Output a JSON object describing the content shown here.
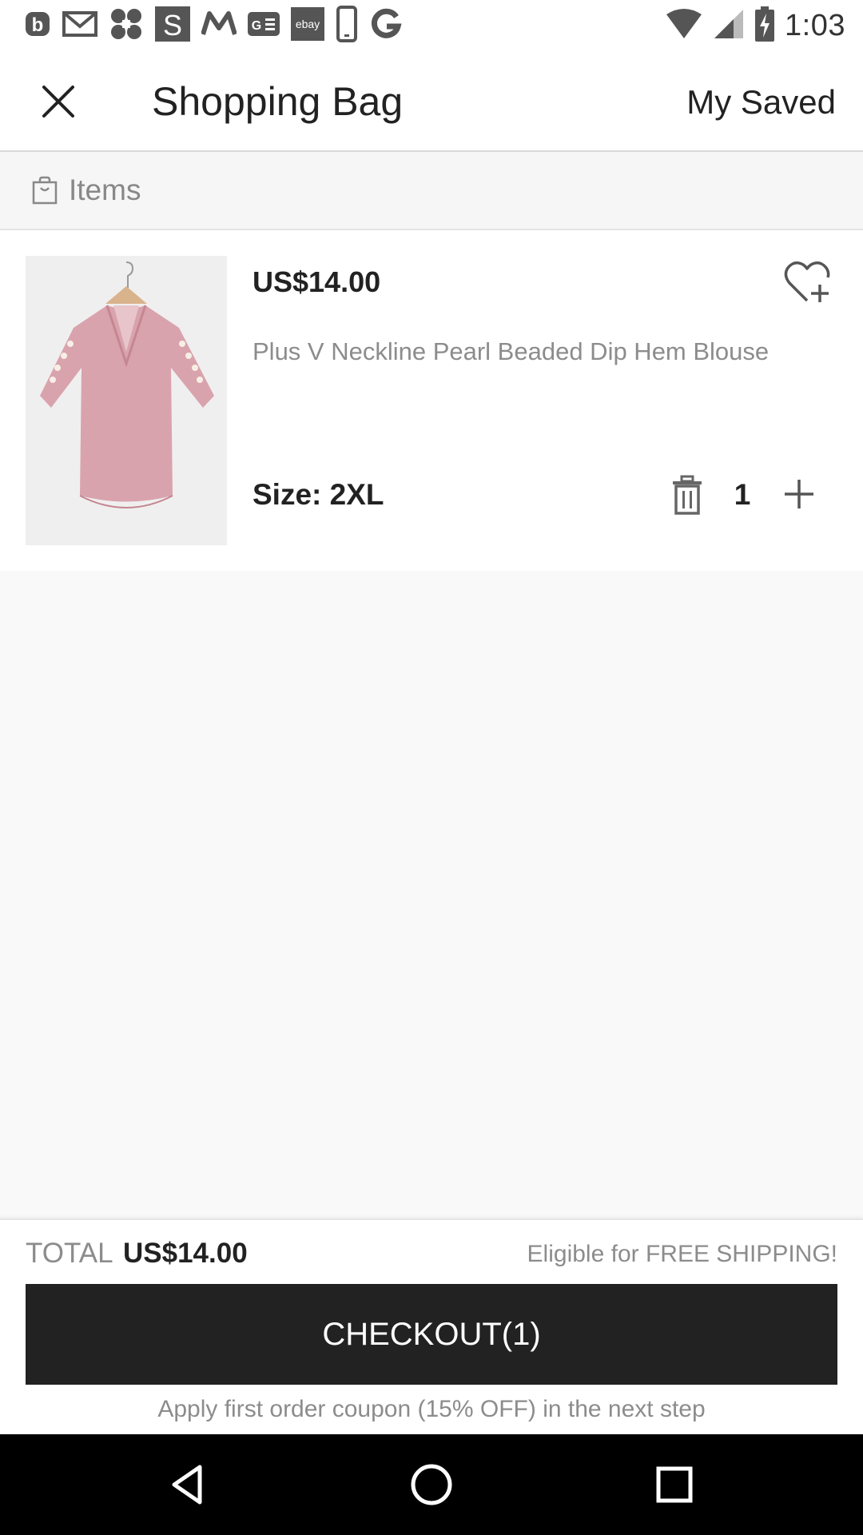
{
  "status_bar": {
    "time": "1:03",
    "notification_icons": [
      "b-app-icon",
      "gmail-icon",
      "pinwheel-app-icon",
      "s-app-icon",
      "myntra-icon",
      "news-icon",
      "ebay-icon",
      "phone-device-icon",
      "g-app-icon"
    ],
    "ebay_label": "ebay",
    "system_icons": [
      "wifi-icon",
      "signal-icon",
      "battery-charging-icon"
    ]
  },
  "header": {
    "title": "Shopping Bag",
    "my_saved_label": "My Saved"
  },
  "items_section": {
    "label": "Items"
  },
  "cart_item": {
    "price": "US$14.00",
    "name": "Plus V Neckline Pearl Beaded Dip Hem Blouse",
    "size": "Size: 2XL",
    "quantity": "1",
    "image_color": "#d9a3ad"
  },
  "footer": {
    "total_label": "TOTAL",
    "total_value": "US$14.00",
    "shipping_note": "Eligible for FREE SHIPPING!",
    "checkout_label": "CHECKOUT(1)",
    "coupon_note": "Apply first order coupon (15% OFF) in the next step"
  },
  "nav_bar": {
    "buttons": [
      "back-icon",
      "home-icon",
      "recents-icon"
    ]
  },
  "colors": {
    "checkout_bg": "#222222",
    "muted_text": "#8c8c8c",
    "page_bg": "#f9f9f9"
  }
}
